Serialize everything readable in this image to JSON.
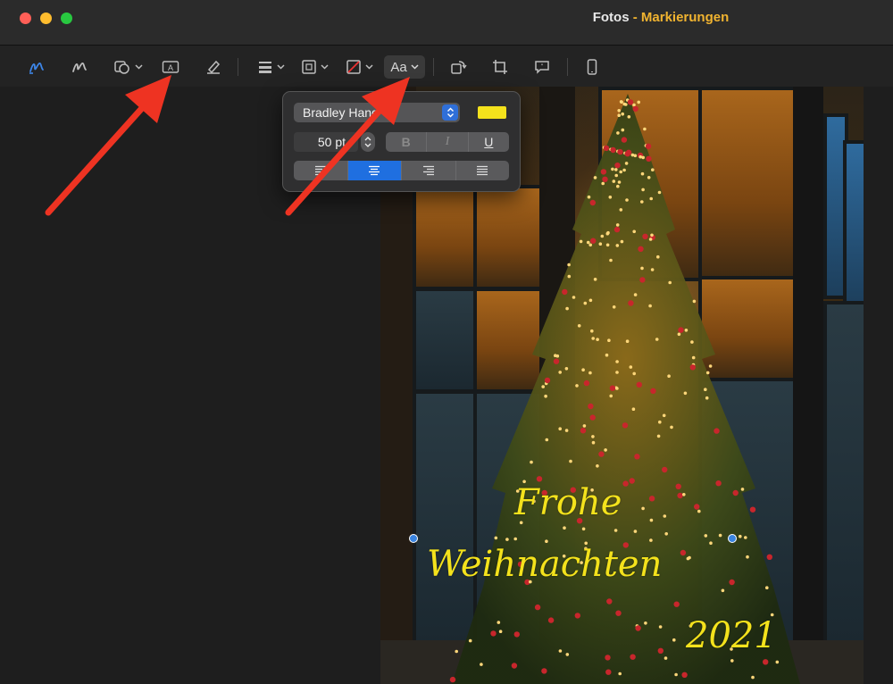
{
  "window": {
    "app": "Fotos",
    "separator": "-",
    "mode": "Markierungen"
  },
  "toolbar": {
    "items": [
      {
        "name": "sketch-icon"
      },
      {
        "name": "draw-icon"
      },
      {
        "name": "shapes-icon"
      },
      {
        "name": "text-icon"
      },
      {
        "name": "highlight-icon"
      },
      {
        "name": "line-style-icon"
      },
      {
        "name": "border-color-icon"
      },
      {
        "name": "fill-color-icon"
      },
      {
        "name": "rotate-icon"
      },
      {
        "name": "crop-icon"
      },
      {
        "name": "description-icon"
      },
      {
        "name": "device-icon"
      }
    ],
    "text_style_label": "Aa"
  },
  "text_popover": {
    "font_name": "Bradley Hand",
    "font_size": "50 pt",
    "text_color": "#f4e21c",
    "bold_label": "B",
    "italic_label": "I",
    "underline_label": "U",
    "selected_alignment": "center"
  },
  "photo": {
    "greeting_line1": "Frohe",
    "greeting_line2": "Weihnachten",
    "greeting_line3": "2021"
  },
  "annotations": {
    "arrow_color": "#ee3322"
  }
}
